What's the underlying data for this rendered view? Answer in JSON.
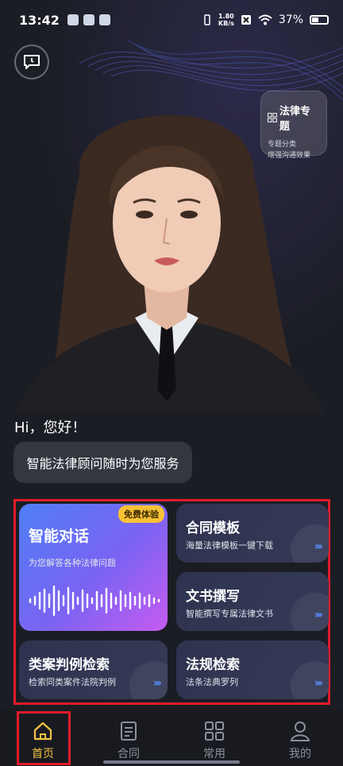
{
  "status_bar": {
    "time": "13:42",
    "net_speed_value": "1.80",
    "net_speed_unit": "KB/s",
    "battery": "37%"
  },
  "hero": {
    "topic_card": {
      "title": "法律专题",
      "line1": "专题分类",
      "line2": "增强沟通效果"
    }
  },
  "greeting": "Hi，您好！",
  "intro_bubble": "智能法律顾问随时为您服务",
  "features": {
    "chat": {
      "title": "智能对话",
      "subtitle": "为您解答各种法律问题",
      "badge": "免费体验"
    },
    "contract": {
      "title": "合同模板",
      "subtitle": "海量法律模板一键下载"
    },
    "document": {
      "title": "文书撰写",
      "subtitle": "智能撰写专属法律文书"
    },
    "case_search": {
      "title": "类案判例检索",
      "subtitle": "检索同类案件法院判例"
    },
    "law_search": {
      "title": "法规检索",
      "subtitle": "法条法典罗列"
    },
    "arrow_glyph": "›››"
  },
  "nav": {
    "items": [
      {
        "label": "首页",
        "icon": "home-icon",
        "active": true
      },
      {
        "label": "合同",
        "icon": "document-icon",
        "active": false
      },
      {
        "label": "常用",
        "icon": "grid-icon",
        "active": false
      },
      {
        "label": "我的",
        "icon": "user-icon",
        "active": false
      }
    ]
  },
  "colors": {
    "accent": "#f6c341",
    "highlight_frame": "#e11b2a",
    "card_gradient_start": "#4f7ef7",
    "card_gradient_end": "#c65cf0"
  }
}
